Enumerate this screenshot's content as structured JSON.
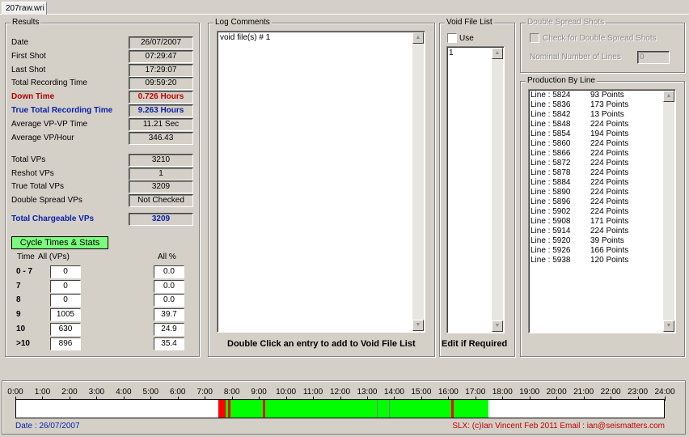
{
  "window": {
    "tab_title": "207raw.wri"
  },
  "results": {
    "title": "Results",
    "rows": [
      {
        "label": "Date",
        "value": "26/07/2007",
        "style": ""
      },
      {
        "label": "First Shot",
        "value": "07:29:47",
        "style": ""
      },
      {
        "label": "Last Shot",
        "value": "17:29:07",
        "style": ""
      },
      {
        "label": "Total Recording Time",
        "value": "09:59:20",
        "style": ""
      },
      {
        "label": "Down Time",
        "value": "0.726 Hours",
        "style": "red"
      },
      {
        "label": "True Total Recording Time",
        "value": "9.263 Hours",
        "style": "blue"
      },
      {
        "label": "Average VP-VP Time",
        "value": "11.21 Sec",
        "style": ""
      },
      {
        "label": "Average VP/Hour",
        "value": "346.43",
        "style": ""
      }
    ],
    "vp_rows": [
      {
        "label": "Total VPs",
        "value": "3210"
      },
      {
        "label": "Reshot VPs",
        "value": "1"
      },
      {
        "label": "True Total VPs",
        "value": "3209"
      },
      {
        "label": "Double Spread VPs",
        "value": "Not Checked"
      }
    ],
    "chargeable": {
      "label": "Total Chargeable VPs",
      "value": "3209"
    },
    "cycle_button": "Cycle Times & Stats",
    "cycle_headers": {
      "time": "Time",
      "all": "All  (VPs)",
      "pct": "All %"
    },
    "cycle_rows": [
      {
        "time": "0 - 7",
        "all": "0",
        "pct": "0.0"
      },
      {
        "time": "7",
        "all": "0",
        "pct": "0.0"
      },
      {
        "time": "8",
        "all": "0",
        "pct": "0.0"
      },
      {
        "time": "9",
        "all": "1005",
        "pct": "39.7"
      },
      {
        "time": "10",
        "all": "630",
        "pct": "24.9"
      },
      {
        "time": ">10",
        "all": "896",
        "pct": "35.4"
      }
    ]
  },
  "log_comments": {
    "title": "Log Comments",
    "text": "void file(s) # 1",
    "caption": "Double Click an entry to add to Void File List"
  },
  "void_file_list": {
    "title": "Void File List",
    "use_label": "Use",
    "use_checked": false,
    "items": [
      "1"
    ],
    "caption": "Edit if Required"
  },
  "double_spread": {
    "title": "Double Spread Shots",
    "check_label": "Check for Double Spread Shots",
    "nominal_label": "Nominal Number of Lines",
    "nominal_value": "0"
  },
  "production": {
    "title": "Production By Line",
    "rows": [
      {
        "line": "Line : 5824",
        "points": "93 Points"
      },
      {
        "line": "Line : 5836",
        "points": "173 Points"
      },
      {
        "line": "Line : 5842",
        "points": "13 Points"
      },
      {
        "line": "Line : 5848",
        "points": "224 Points"
      },
      {
        "line": "Line : 5854",
        "points": "194 Points"
      },
      {
        "line": "Line : 5860",
        "points": "224 Points"
      },
      {
        "line": "Line : 5866",
        "points": "224 Points"
      },
      {
        "line": "Line : 5872",
        "points": "224 Points"
      },
      {
        "line": "Line : 5878",
        "points": "224 Points"
      },
      {
        "line": "Line : 5884",
        "points": "224 Points"
      },
      {
        "line": "Line : 5890",
        "points": "224 Points"
      },
      {
        "line": "Line : 5896",
        "points": "224 Points"
      },
      {
        "line": "Line : 5902",
        "points": "224 Points"
      },
      {
        "line": "Line : 5908",
        "points": "171 Points"
      },
      {
        "line": "Line : 5914",
        "points": "224 Points"
      },
      {
        "line": "Line : 5920",
        "points": "39 Points"
      },
      {
        "line": "Line : 5926",
        "points": "166 Points"
      },
      {
        "line": "Line : 5938",
        "points": "120 Points"
      }
    ]
  },
  "timeline": {
    "hours": [
      "0:00",
      "1:00",
      "2:00",
      "3:00",
      "4:00",
      "5:00",
      "6:00",
      "7:00",
      "8:00",
      "9:00",
      "10:00",
      "11:00",
      "12:00",
      "13:00",
      "14:00",
      "15:00",
      "16:00",
      "17:00",
      "18:00",
      "19:00",
      "20:00",
      "21:00",
      "22:00",
      "23:00",
      "24:00"
    ],
    "green_color": "#00ff00",
    "red_color": "#ff0000",
    "green_span": [
      7.5,
      17.49
    ],
    "red_spans": [
      [
        7.5,
        7.76
      ],
      [
        7.86,
        7.92
      ],
      [
        9.15,
        9.25
      ],
      [
        16.1,
        16.17
      ]
    ],
    "dividers": [
      13.35,
      13.8
    ],
    "date_label": "Date : 26/07/2007",
    "credit": "SLX: (c)Ian Vincent Feb 2011 Email : ian@seismatters.com"
  }
}
